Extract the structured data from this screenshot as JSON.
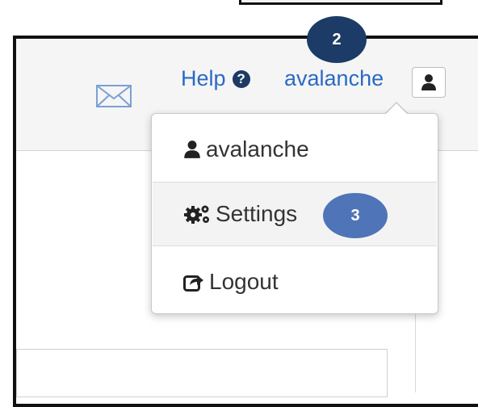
{
  "header": {
    "help_label": "Help",
    "help_icon_glyph": "?",
    "username": "avalanche"
  },
  "user_menu": {
    "items": [
      {
        "label": "avalanche",
        "icon": "user-icon"
      },
      {
        "label": "Settings",
        "icon": "cogs-icon"
      },
      {
        "label": "Logout",
        "icon": "share-icon"
      }
    ]
  },
  "callouts": {
    "step_2": "2",
    "step_3": "3"
  },
  "colors": {
    "link": "#2a6ac4",
    "callout_dark": "#1c3b66",
    "callout_light": "#4f74b7"
  }
}
